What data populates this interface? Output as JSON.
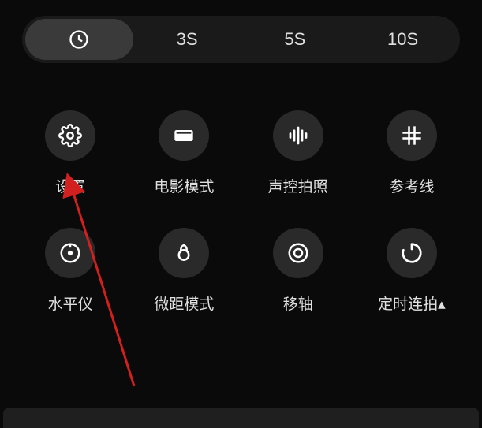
{
  "timer": {
    "segments": [
      {
        "id": "instant",
        "label": "",
        "icon": "clock",
        "active": true
      },
      {
        "id": "3s",
        "label": "3S",
        "active": false
      },
      {
        "id": "5s",
        "label": "5S",
        "active": false
      },
      {
        "id": "10s",
        "label": "10S",
        "active": false
      }
    ]
  },
  "grid": {
    "items": [
      {
        "id": "settings",
        "label": "设置",
        "icon": "gear"
      },
      {
        "id": "movie",
        "label": "电影模式",
        "icon": "movie"
      },
      {
        "id": "voice",
        "label": "声控拍照",
        "icon": "voice"
      },
      {
        "id": "grid",
        "label": "参考线",
        "icon": "grid"
      },
      {
        "id": "level",
        "label": "水平仪",
        "icon": "level"
      },
      {
        "id": "macro",
        "label": "微距模式",
        "icon": "macro"
      },
      {
        "id": "tilt",
        "label": "移轴",
        "icon": "tiltshift"
      },
      {
        "id": "timelapse",
        "label": "定时连拍▴",
        "icon": "timer"
      }
    ]
  },
  "annotation": {
    "arrow_color": "#d21f1f"
  }
}
